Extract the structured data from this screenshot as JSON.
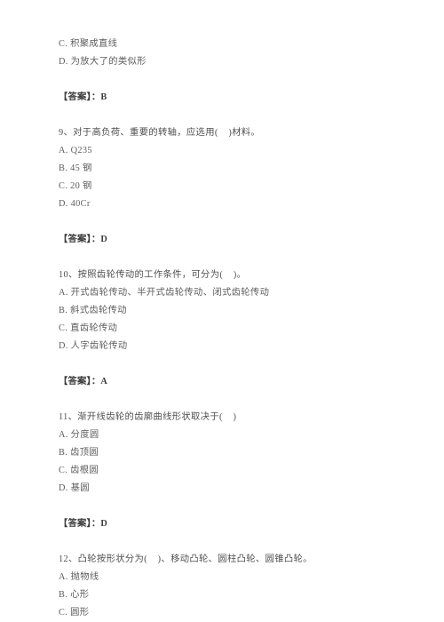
{
  "document": {
    "type": "exam-question-sheet",
    "language": "zh-CN",
    "background_color": "#ffffff",
    "text_color": "#5a5a5a",
    "answer_prefix": "【答案】：",
    "blocks": [
      {
        "kind": "orphan-options",
        "options": [
          "C. 积聚成直线",
          "D. 为放大了的类似形"
        ],
        "answer": "【答案】：B"
      },
      {
        "kind": "question",
        "stem": "9、对于高负荷、重要的转轴，应选用(    )材料。",
        "options": [
          "A. Q235",
          "B. 45 钢",
          "C. 20 钢",
          "D. 40Cr"
        ],
        "answer": "【答案】：D"
      },
      {
        "kind": "question",
        "stem": "10、按照齿轮传动的工作条件，可分为(    )。",
        "options": [
          "A. 开式齿轮传动、半开式齿轮传动、闭式齿轮传动",
          "B. 斜式齿轮传动",
          "C. 直齿轮传动",
          "D. 人字齿轮传动"
        ],
        "answer": "【答案】：A"
      },
      {
        "kind": "question",
        "stem": "11、渐开线齿轮的齿廓曲线形状取决于(    )",
        "options": [
          "A. 分度圆",
          "B. 齿顶圆",
          "C. 齿根圆",
          "D. 基圆"
        ],
        "answer": "【答案】：D"
      },
      {
        "kind": "question",
        "stem": "12、凸轮按形状分为(    )、移动凸轮、圆柱凸轮、圆锥凸轮。",
        "options": [
          "A. 抛物线",
          "B. 心形",
          "C. 圆形"
        ],
        "answer": ""
      }
    ]
  }
}
